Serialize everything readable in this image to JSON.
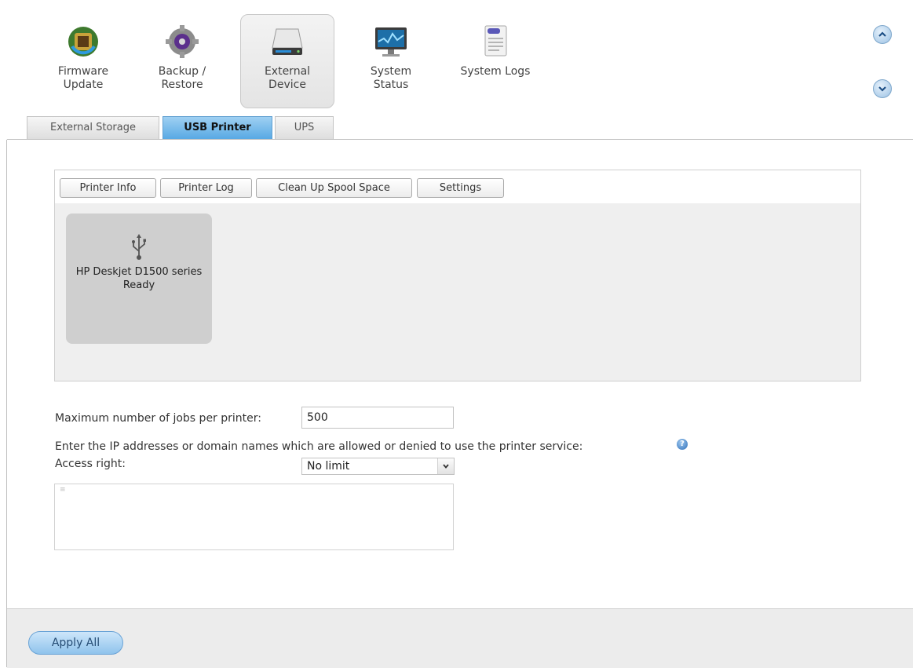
{
  "toolbar": {
    "items": [
      {
        "label": "Firmware\nUpdate",
        "icon": "firmware-update-icon"
      },
      {
        "label": "Backup /\nRestore",
        "icon": "backup-restore-icon"
      },
      {
        "label": "External\nDevice",
        "icon": "external-device-icon",
        "active": true
      },
      {
        "label": "System\nStatus",
        "icon": "system-status-icon"
      },
      {
        "label": "System Logs",
        "icon": "system-logs-icon"
      }
    ],
    "scroll_up": "^",
    "scroll_down": "v"
  },
  "subtabs": [
    {
      "label": "External Storage"
    },
    {
      "label": "USB Printer",
      "active": true
    },
    {
      "label": "UPS"
    }
  ],
  "printer_panel": {
    "buttons": [
      "Printer Info",
      "Printer Log",
      "Clean Up Spool Space",
      "Settings"
    ],
    "printer": {
      "name": "HP Deskjet D1500 series",
      "status": "Ready",
      "icon": "usb-icon"
    }
  },
  "form": {
    "max_jobs_label": "Maximum number of jobs per printer:",
    "max_jobs_value": "500",
    "ip_description": "Enter the IP addresses or domain names which are allowed or denied to use the printer service:",
    "access_label": "Access right:",
    "access_value": "No limit",
    "help_glyph": "?"
  },
  "footer": {
    "apply_label": "Apply All"
  },
  "colors": {
    "accent": "#58a9e4",
    "panel_bg": "#efefef",
    "card_bg": "#cfcfcf",
    "footer_bg": "#ececec"
  }
}
